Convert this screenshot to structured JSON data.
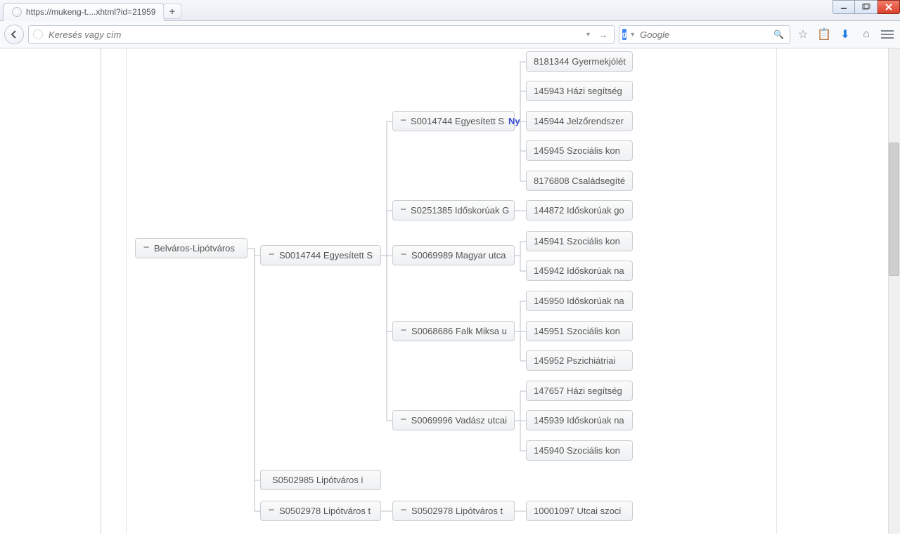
{
  "browser": {
    "tab_title": "https://mukeng-t....xhtml?id=21959",
    "url_placeholder": "Keresés vagy cím",
    "search_placeholder": "Google"
  },
  "tree": {
    "l0": {
      "label": "Belváros-Lipótváros"
    },
    "l1a": {
      "label": "S0014744 Egyesített S"
    },
    "l1b": {
      "label": "S0502985 Lipótváros i"
    },
    "l1c": {
      "label": "S0502978 Lipótváros t"
    },
    "l2a": {
      "label": "S0014744 Egyesített S ",
      "badge": "Ny"
    },
    "l2b": {
      "label": "S0251385 Időskorúak G"
    },
    "l2c": {
      "label": "S0069989 Magyar utca"
    },
    "l2d": {
      "label": "S0068686 Falk Miksa u"
    },
    "l2e": {
      "label": "S0069996 Vadász utcai"
    },
    "l2f": {
      "label": "S0502978 Lipótváros t"
    },
    "l3_01": {
      "label": "8181344 Gyermekjólét"
    },
    "l3_02": {
      "label": "145943 Házi segítség"
    },
    "l3_03": {
      "label": "145944 Jelzőrendszer"
    },
    "l3_04": {
      "label": "145945 Szociális kon"
    },
    "l3_05": {
      "label": "8176808 Családsegíté"
    },
    "l3_06": {
      "label": "144872 Időskorúak go"
    },
    "l3_07": {
      "label": "145941 Szociális kon"
    },
    "l3_08": {
      "label": "145942 Időskorúak na"
    },
    "l3_09": {
      "label": "145950 Időskorúak na"
    },
    "l3_10": {
      "label": "145951 Szociális kon"
    },
    "l3_11": {
      "label": "145952 Pszichiátriai"
    },
    "l3_12": {
      "label": "147657 Házi segítség"
    },
    "l3_13": {
      "label": "145939 Időskorúak na"
    },
    "l3_14": {
      "label": "145940 Szociális kon"
    },
    "l3_15": {
      "label": "10001097 Utcai szoci"
    }
  }
}
